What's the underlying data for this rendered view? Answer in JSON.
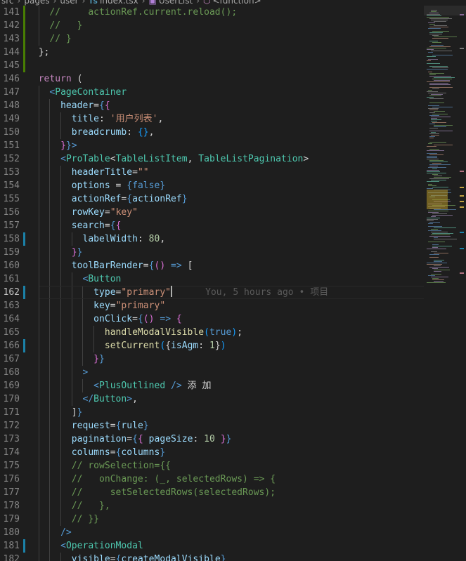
{
  "breadcrumb": {
    "items": [
      "src",
      "pages",
      "user",
      "index.tsx",
      "UserList",
      "<function>"
    ],
    "ts_badge": "TS"
  },
  "editor": {
    "active_line": 162,
    "blame_text": "You, 5 hours ago • 项目",
    "lines": [
      {
        "n": "141",
        "tokens": [
          [
            "cm",
            "    //     actionRef.current.reload();"
          ]
        ]
      },
      {
        "n": "142",
        "tokens": [
          [
            "cm",
            "    //   }"
          ]
        ]
      },
      {
        "n": "143",
        "tokens": [
          [
            "cm",
            "    // }"
          ]
        ]
      },
      {
        "n": "144",
        "tokens": [
          [
            "p",
            "  };"
          ]
        ]
      },
      {
        "n": "145",
        "tokens": [
          [
            "p",
            ""
          ]
        ]
      },
      {
        "n": "146",
        "tokens": [
          [
            "k",
            "  return"
          ],
          [
            "p",
            " ("
          ]
        ]
      },
      {
        "n": "147",
        "tokens": [
          [
            "t",
            "    <"
          ],
          [
            "c",
            "PageContainer"
          ]
        ]
      },
      {
        "n": "148",
        "tokens": [
          [
            "a",
            "      header"
          ],
          [
            "p",
            "="
          ],
          [
            "t",
            "{"
          ],
          [
            "br",
            "{"
          ]
        ]
      },
      {
        "n": "149",
        "tokens": [
          [
            "a",
            "        title"
          ],
          [
            "p",
            ": "
          ],
          [
            "s",
            "'用户列表'"
          ],
          [
            "p",
            ","
          ]
        ]
      },
      {
        "n": "150",
        "tokens": [
          [
            "a",
            "        breadcrumb"
          ],
          [
            "p",
            ": "
          ],
          [
            "br2",
            "{}"
          ],
          [
            "p",
            ","
          ]
        ]
      },
      {
        "n": "151",
        "tokens": [
          [
            "br",
            "      }"
          ],
          [
            "t",
            "}"
          ],
          [
            "t",
            ">"
          ]
        ]
      },
      {
        "n": "152",
        "tokens": [
          [
            "t",
            "      <"
          ],
          [
            "c",
            "ProTable"
          ],
          [
            "p",
            "<"
          ],
          [
            "c",
            "TableListItem"
          ],
          [
            "p",
            ", "
          ],
          [
            "c",
            "TableListPagination"
          ],
          [
            "p",
            ">"
          ]
        ]
      },
      {
        "n": "153",
        "tokens": [
          [
            "a",
            "        headerTitle"
          ],
          [
            "p",
            "="
          ],
          [
            "s",
            "\"\""
          ]
        ]
      },
      {
        "n": "154",
        "tokens": [
          [
            "a",
            "        options"
          ],
          [
            "p",
            " = "
          ],
          [
            "t",
            "{false}"
          ]
        ]
      },
      {
        "n": "155",
        "tokens": [
          [
            "a",
            "        actionRef"
          ],
          [
            "p",
            "="
          ],
          [
            "t",
            "{"
          ],
          [
            "a",
            "actionRef"
          ],
          [
            "t",
            "}"
          ]
        ]
      },
      {
        "n": "156",
        "tokens": [
          [
            "a",
            "        rowKey"
          ],
          [
            "p",
            "="
          ],
          [
            "s",
            "\"key\""
          ]
        ]
      },
      {
        "n": "157",
        "tokens": [
          [
            "a",
            "        search"
          ],
          [
            "p",
            "="
          ],
          [
            "t",
            "{"
          ],
          [
            "br",
            "{"
          ]
        ]
      },
      {
        "n": "158",
        "tokens": [
          [
            "a",
            "          labelWidth"
          ],
          [
            "p",
            ": "
          ],
          [
            "n",
            "80"
          ],
          [
            "p",
            ","
          ]
        ]
      },
      {
        "n": "159",
        "tokens": [
          [
            "br",
            "        }"
          ],
          [
            "t",
            "}"
          ]
        ]
      },
      {
        "n": "160",
        "tokens": [
          [
            "a",
            "        toolBarRender"
          ],
          [
            "p",
            "="
          ],
          [
            "t",
            "{"
          ],
          [
            "br",
            "()"
          ],
          [
            "t",
            " =>"
          ],
          [
            "p",
            " ["
          ]
        ]
      },
      {
        "n": "161",
        "tokens": [
          [
            "t",
            "          <"
          ],
          [
            "c",
            "Button"
          ]
        ]
      },
      {
        "n": "162",
        "tokens": [
          [
            "a",
            "            type"
          ],
          [
            "p",
            "="
          ],
          [
            "s",
            "\"primary\""
          ]
        ],
        "cursor": true
      },
      {
        "n": "163",
        "tokens": [
          [
            "a",
            "            key"
          ],
          [
            "p",
            "="
          ],
          [
            "s",
            "\"primary\""
          ]
        ]
      },
      {
        "n": "164",
        "tokens": [
          [
            "a",
            "            onClick"
          ],
          [
            "p",
            "="
          ],
          [
            "t",
            "{"
          ],
          [
            "br",
            "()"
          ],
          [
            "t",
            " =>"
          ],
          [
            "p",
            " "
          ],
          [
            "br",
            "{"
          ]
        ]
      },
      {
        "n": "165",
        "tokens": [
          [
            "f",
            "              handleModalVisible"
          ],
          [
            "br2",
            "("
          ],
          [
            "t",
            "true"
          ],
          [
            "br2",
            ")"
          ],
          [
            "p",
            ";"
          ]
        ]
      },
      {
        "n": "166",
        "tokens": [
          [
            "f",
            "              setCurrent"
          ],
          [
            "br2",
            "("
          ],
          [
            "p",
            "{"
          ],
          [
            "a",
            "isAgm"
          ],
          [
            "p",
            ": "
          ],
          [
            "n",
            "1"
          ],
          [
            "p",
            "}"
          ],
          [
            "br2",
            ")"
          ]
        ]
      },
      {
        "n": "167",
        "tokens": [
          [
            "br",
            "            }"
          ],
          [
            "t",
            "}"
          ]
        ]
      },
      {
        "n": "168",
        "tokens": [
          [
            "t",
            "          >"
          ]
        ]
      },
      {
        "n": "169",
        "tokens": [
          [
            "t",
            "            <"
          ],
          [
            "c",
            "PlusOutlined"
          ],
          [
            "t",
            " />"
          ],
          [
            "p",
            " 添 加"
          ]
        ]
      },
      {
        "n": "170",
        "tokens": [
          [
            "t",
            "          </"
          ],
          [
            "c",
            "Button"
          ],
          [
            "t",
            ">"
          ],
          [
            "p",
            ","
          ]
        ]
      },
      {
        "n": "171",
        "tokens": [
          [
            "p",
            "        ]"
          ],
          [
            "t",
            "}"
          ]
        ]
      },
      {
        "n": "172",
        "tokens": [
          [
            "a",
            "        request"
          ],
          [
            "p",
            "="
          ],
          [
            "t",
            "{"
          ],
          [
            "a",
            "rule"
          ],
          [
            "t",
            "}"
          ]
        ]
      },
      {
        "n": "173",
        "tokens": [
          [
            "a",
            "        pagination"
          ],
          [
            "p",
            "="
          ],
          [
            "t",
            "{"
          ],
          [
            "br",
            "{ "
          ],
          [
            "a",
            "pageSize"
          ],
          [
            "p",
            ": "
          ],
          [
            "n",
            "10"
          ],
          [
            "br",
            " }"
          ],
          [
            "t",
            "}"
          ]
        ]
      },
      {
        "n": "174",
        "tokens": [
          [
            "a",
            "        columns"
          ],
          [
            "p",
            "="
          ],
          [
            "t",
            "{"
          ],
          [
            "a",
            "columns"
          ],
          [
            "t",
            "}"
          ]
        ]
      },
      {
        "n": "175",
        "tokens": [
          [
            "cm",
            "        // rowSelection={{"
          ]
        ]
      },
      {
        "n": "176",
        "tokens": [
          [
            "cm",
            "        //   onChange: (_, selectedRows) => {"
          ]
        ]
      },
      {
        "n": "177",
        "tokens": [
          [
            "cm",
            "        //     setSelectedRows(selectedRows);"
          ]
        ]
      },
      {
        "n": "178",
        "tokens": [
          [
            "cm",
            "        //   },"
          ]
        ]
      },
      {
        "n": "179",
        "tokens": [
          [
            "cm",
            "        // }}"
          ]
        ]
      },
      {
        "n": "180",
        "tokens": [
          [
            "t",
            "      />"
          ]
        ]
      },
      {
        "n": "181",
        "tokens": [
          [
            "t",
            "      <"
          ],
          [
            "c",
            "OperationModal"
          ]
        ]
      },
      {
        "n": "182",
        "tokens": [
          [
            "a",
            "        visible"
          ],
          [
            "p",
            "="
          ],
          [
            "t",
            "{"
          ],
          [
            "a",
            "createModalVisible"
          ],
          [
            "t",
            "}"
          ]
        ]
      }
    ]
  },
  "colors": {
    "background": "#1e1e1e",
    "gutter_modified": "#1b81a8",
    "gutter_added": "#487e02"
  }
}
